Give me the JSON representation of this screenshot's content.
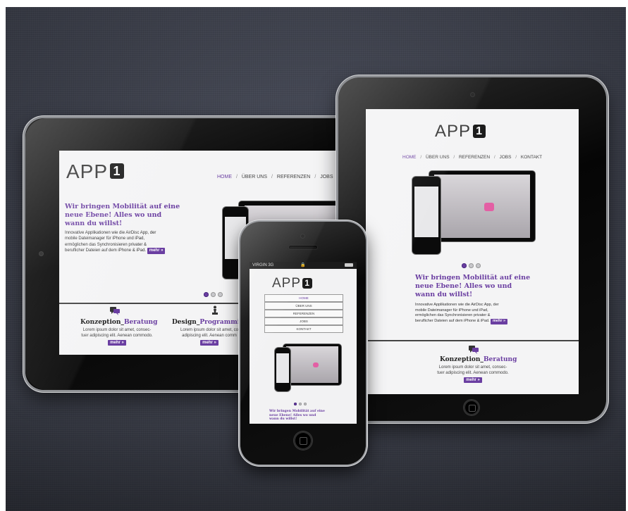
{
  "brand": {
    "logo_text": "APP",
    "logo_number": "1"
  },
  "nav": {
    "home": "HOME",
    "ueber_uns": "ÜBER UNS",
    "referenzen": "REFERENZEN",
    "jobs": "JOBS",
    "kontakt": "KONTAKT",
    "separator": "/"
  },
  "hero": {
    "headline_line1": "Wir bringen Mobilität auf eine",
    "headline_line2": "neue Ebene! Alles wo und",
    "headline_line3": "wann du willst!",
    "body_line1": "Innovative Applikationen wie die AirDisc App, der",
    "body_line2": "mobile Dateimanager für iPhone und iPad,",
    "body_line3": "ermöglichen das Synchronisieren privater &",
    "body_line4": "beruflicher Dateien auf dem iPhone & iPad.",
    "more_label": "mehr »"
  },
  "services": {
    "konzeption_title_prefix": "Konzeption_",
    "konzeption_title_accent": "Beratung",
    "design_title_prefix": "Design_",
    "design_title_accent": "Programmie",
    "lorem_line1": "Lorem ipsum dolor sit amet, consec-",
    "lorem_line2": "tuer adipiscing elit. Aenean commodo.",
    "lorem_line2_partial": "adipiscing elit. Aenean comm",
    "lorem_line1_partial": "Lorem ipsum dolor sit amet, co",
    "more_label": "mehr »",
    "icons": {
      "konzeption": "speech-bubbles-icon",
      "design": "chess-piece-icon"
    }
  },
  "iphone": {
    "carrier": "VIRGIN 3G",
    "headline_line1": "Wir bringen Mobilität auf eine",
    "headline_line2": "neue Ebene! Alles wo und",
    "headline_line3": "wann du willst!"
  },
  "colors": {
    "accent": "#6a3ea1",
    "background": "#3c3f4a"
  }
}
